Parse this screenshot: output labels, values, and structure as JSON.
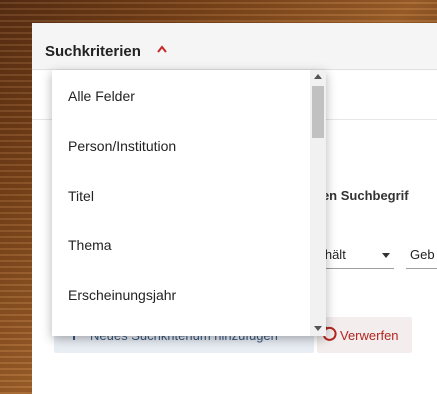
{
  "header": {
    "title": "Suchkriterien"
  },
  "form": {
    "search_hint": "nen Suchbegrif",
    "operator": "nthält",
    "field_partial": "Geb"
  },
  "buttons": {
    "add_label": "Neues Suchkriterium hinzufügen",
    "reset_label": "Verwerfen"
  },
  "dropdown": {
    "items": [
      {
        "label": "Alle Felder"
      },
      {
        "label": "Person/Institution"
      },
      {
        "label": "Titel"
      },
      {
        "label": "Thema"
      },
      {
        "label": "Erscheinungsjahr"
      }
    ]
  },
  "colors": {
    "accent": "#c62828",
    "button_add_bg": "#e9eef5",
    "button_reset_bg": "#f3eded"
  },
  "icons": {
    "header_toggle": "chevron-up-icon",
    "reset": "undo-icon",
    "add": "plus-icon"
  }
}
